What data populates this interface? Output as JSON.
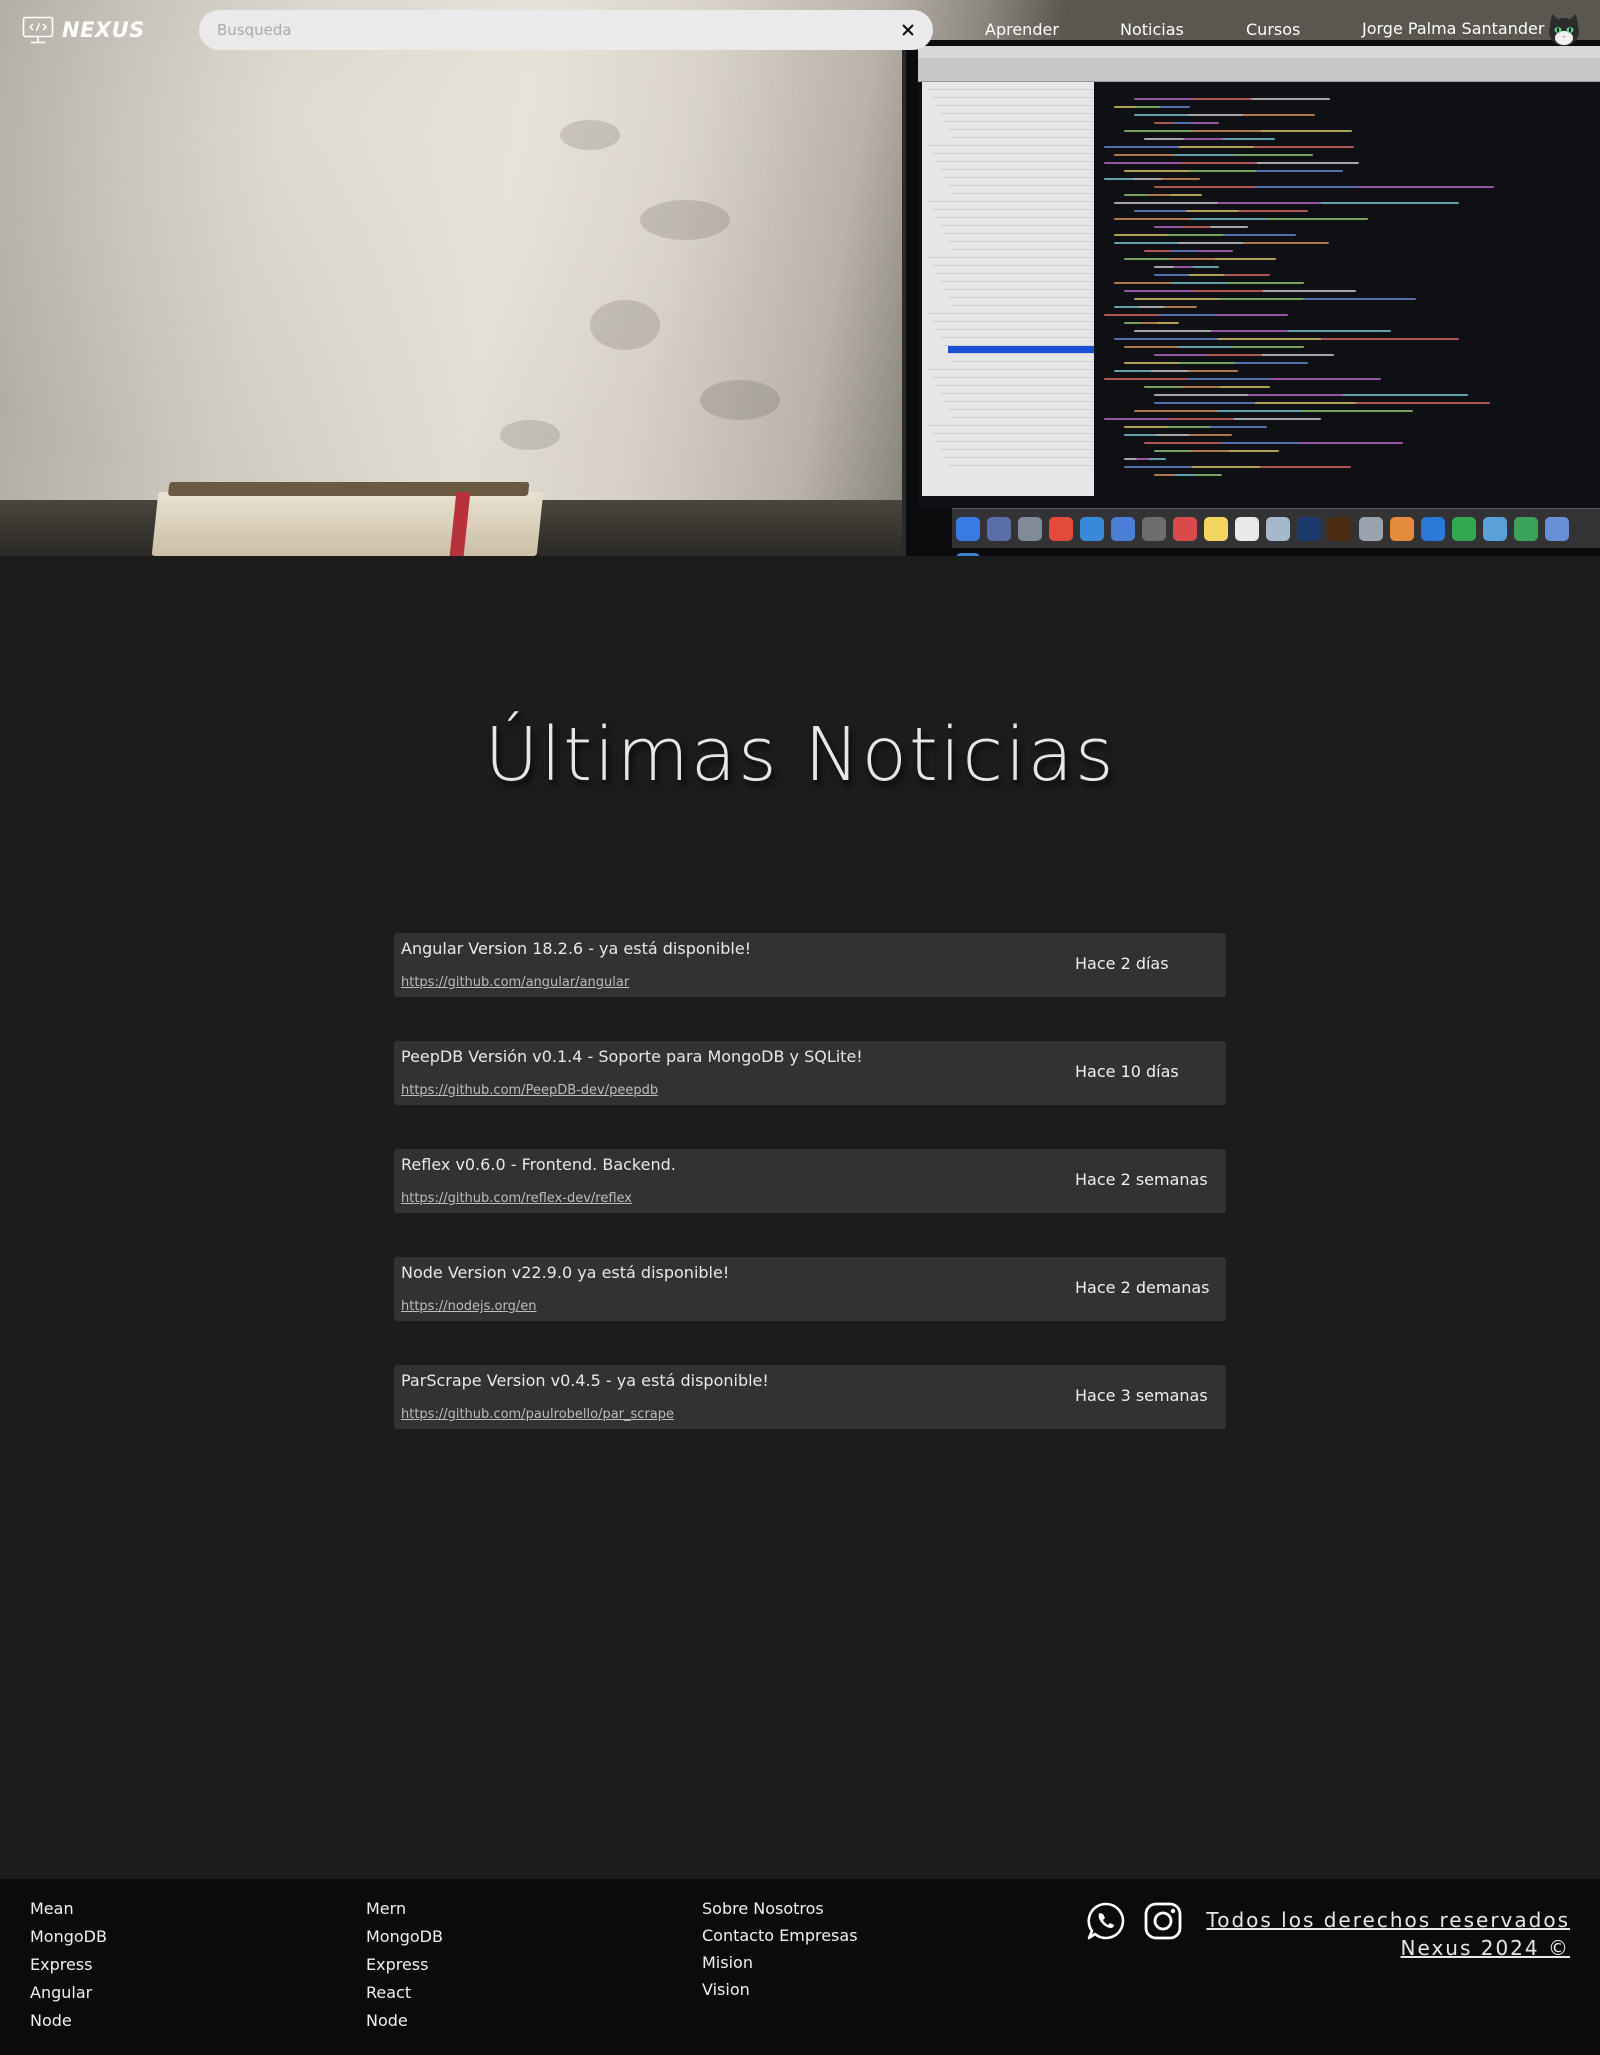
{
  "nav": {
    "brand": "NEXUS",
    "search_placeholder": "Busqueda",
    "links": [
      "Aprender",
      "Noticias",
      "Cursos"
    ],
    "user_name": "Jorge Palma Santander"
  },
  "main": {
    "title": "Últimas Noticias",
    "news": [
      {
        "title": "Angular Version 18.2.6 - ya está disponible!",
        "link": "https://github.com/angular/angular",
        "time": "Hace 2 días"
      },
      {
        "title": "PeepDB  Versión v0.1.4 - Soporte para MongoDB y SQLite!",
        "link": "https://github.com/PeepDB-dev/peepdb",
        "time": "Hace 10 días"
      },
      {
        "title": "Reflex v0.6.0 - Frontend. Backend.",
        "link": "https://github.com/reflex-dev/reflex",
        "time": "Hace 2 semanas"
      },
      {
        "title": "Node Version v22.9.0 ya está disponible!",
        "link": "https://nodejs.org/en",
        "time": "Hace 2 demanas"
      },
      {
        "title": "ParScrape Version v0.4.5 - ya está disponible!",
        "link": "https://github.com/paulrobello/par_scrape",
        "time": "Hace 3 semanas"
      }
    ]
  },
  "footer": {
    "col1": [
      "Mean",
      "MongoDB",
      "Express",
      "Angular",
      "Node"
    ],
    "col2": [
      "Mern",
      "MongoDB",
      "Express",
      "React",
      "Node"
    ],
    "col3": [
      "Sobre Nosotros",
      "Contacto Empresas",
      "Mision",
      "Vision"
    ],
    "rights_line1": "Todos los derechos reservados",
    "rights_line2": "Nexus 2024 ©"
  },
  "icons": {
    "logo": "monitor-code-icon",
    "clear": "close-icon",
    "avatar": "cat-avatar-icon",
    "whatsapp": "whatsapp-icon",
    "instagram": "instagram-icon"
  }
}
